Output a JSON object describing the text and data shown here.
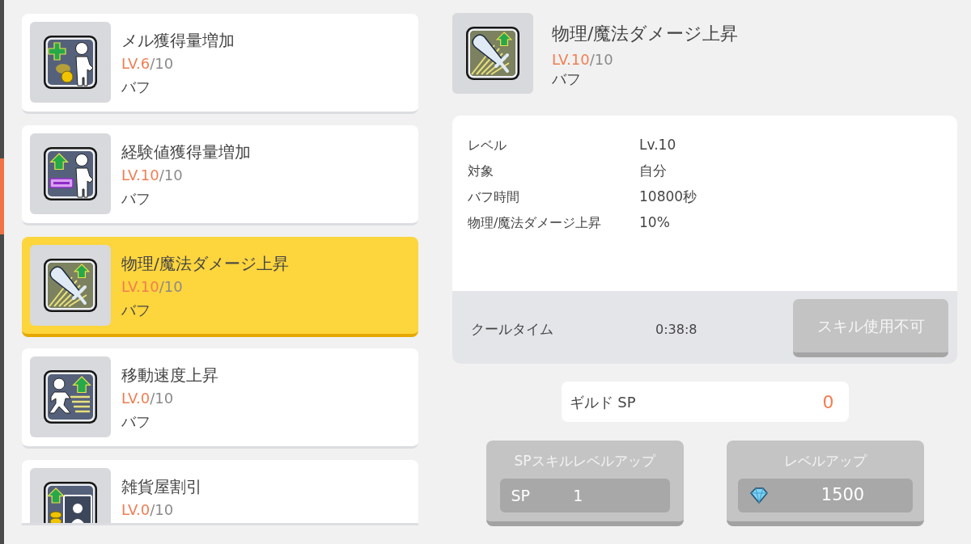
{
  "skills": [
    {
      "name": "メル獲得量増加",
      "level": "LV.6",
      "max": "/10",
      "type": "バフ",
      "selected": false
    },
    {
      "name": "経験値獲得量増加",
      "level": "LV.10",
      "max": "/10",
      "type": "バフ",
      "selected": false
    },
    {
      "name": "物理/魔法ダメージ上昇",
      "level": "LV.10",
      "max": "/10",
      "type": "バフ",
      "selected": true
    },
    {
      "name": "移動速度上昇",
      "level": "LV.0",
      "max": "/10",
      "type": "バフ",
      "selected": false
    },
    {
      "name": "雑貨屋割引",
      "level": "LV.0",
      "max": "/10",
      "selected": false
    }
  ],
  "detail": {
    "name": "物理/魔法ダメージ上昇",
    "level": "LV.10",
    "max": "/10",
    "type": "バフ",
    "stats": [
      {
        "label": "レベル",
        "value": "Lv.10"
      },
      {
        "label": "対象",
        "value": "自分"
      },
      {
        "label": "バフ時間",
        "value": "10800秒"
      },
      {
        "label": "物理/魔法ダメージ上昇",
        "value": "10%"
      }
    ],
    "cooldown": {
      "label": "クールタイム",
      "value": "0:38:8"
    },
    "use_button": {
      "label": "スキル使用不可",
      "disabled": true
    }
  },
  "guild_sp": {
    "label": "ギルド SP",
    "value": "0"
  },
  "actions": [
    {
      "kind": "sp",
      "label": "SPスキルレベルアップ",
      "currency": "SP",
      "cost": "1",
      "disabled": true
    },
    {
      "kind": "gem",
      "label": "レベルアップ",
      "cost": "1500",
      "disabled": true
    }
  ]
}
